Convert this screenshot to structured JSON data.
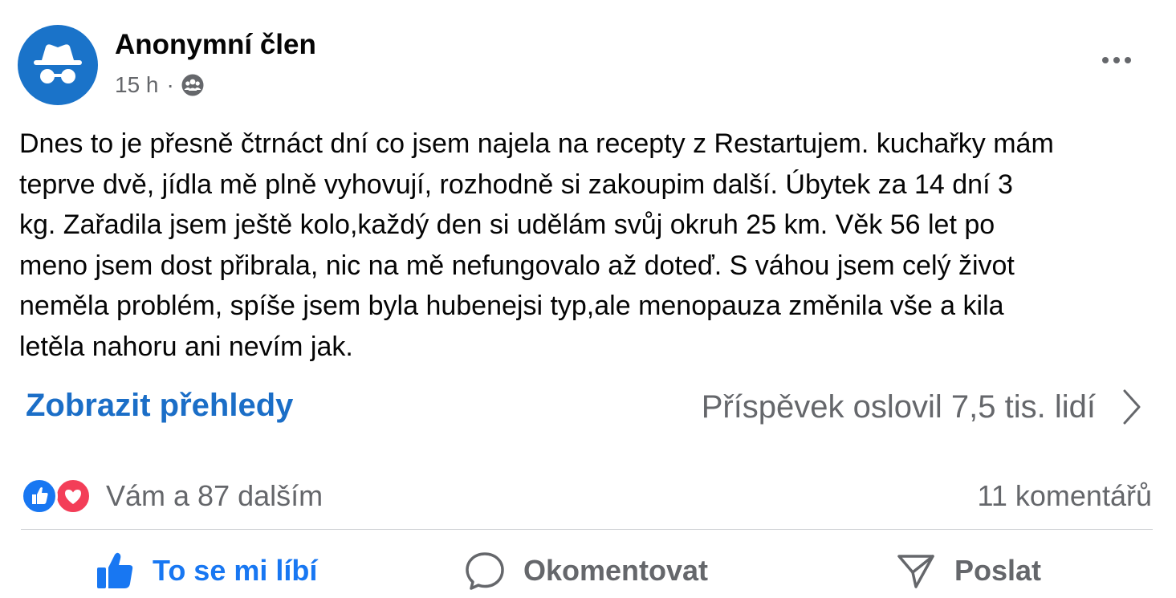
{
  "post": {
    "author": "Anonymní člen",
    "time": "15 h",
    "separator": "·",
    "audience_icon": "group-icon",
    "text_lines": [
      "Dnes to je přesně čtrnáct dní co jsem najela na recepty z Restartujem. kuchařky mám",
      "teprve dvě, jídla mě plně vyhovují, rozhodně si zakoupim další.  Úbytek za 14 dní 3",
      "kg. Zařadila jsem ještě kolo,každý den si udělám svůj okruh 25 km. Věk 56 let po",
      "meno jsem dost přibrala, nic na mě nefungovalo až doteď. S váhou jsem celý život",
      "neměla problém, spíše jsem byla hubenejsi typ,ale menopauza změnila vše a kila",
      "letěla nahoru ani nevím jak."
    ]
  },
  "insights": {
    "link_label": "Zobrazit přehledy",
    "reach_text": "Příspěvek oslovil 7,5 tis. lidí"
  },
  "reactions": {
    "summary": "Vám a 87 dalším",
    "icons": [
      "like-icon",
      "love-icon"
    ],
    "comments": "11 komentářů"
  },
  "actions": {
    "like": "To se mi líbí",
    "comment": "Okomentovat",
    "share": "Poslat"
  },
  "colors": {
    "accent_blue": "#1877f2",
    "link_blue": "#1b6ec7",
    "avatar_blue": "#1a73c9",
    "love_red": "#f33e58",
    "muted_gray": "#65676b"
  }
}
